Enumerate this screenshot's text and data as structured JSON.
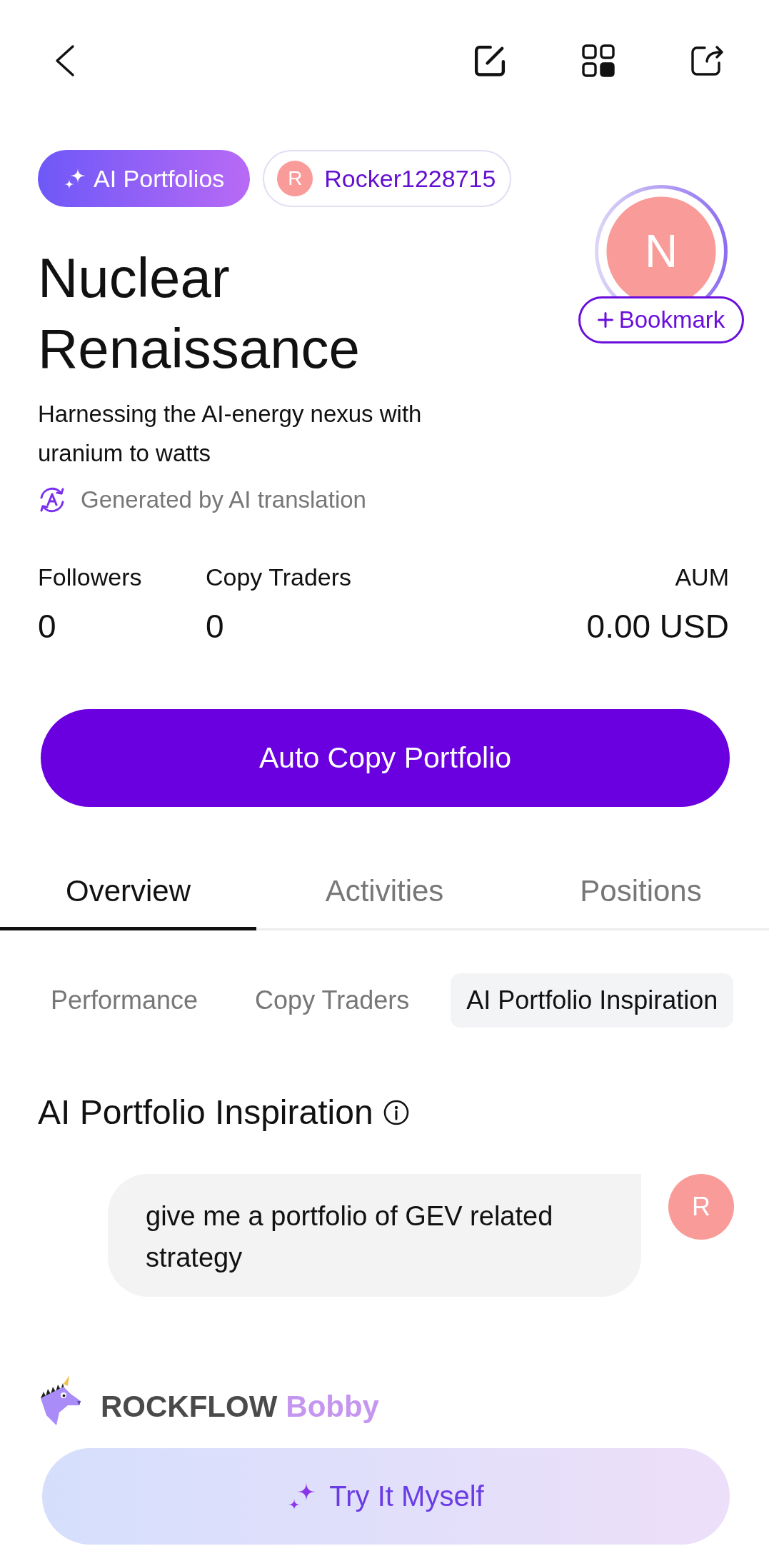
{
  "badges": [
    {
      "kind": "ai",
      "label": "AI Portfolios"
    },
    {
      "kind": "user",
      "initial": "R",
      "label": "Rocker1228715"
    }
  ],
  "portfolio": {
    "title": "Nuclear Renaissance",
    "avatar_initial": "N",
    "bookmark": "Bookmark",
    "description": "Harnessing the AI-energy nexus with uranium to watts",
    "translation_note": "Generated by AI translation"
  },
  "stats": [
    {
      "label": "Followers",
      "value": "0"
    },
    {
      "label": "Copy Traders",
      "value": "0"
    },
    {
      "label": "AUM",
      "value": "0.00 USD"
    }
  ],
  "primary_button": "Auto Copy Portfolio",
  "tabs": [
    {
      "label": "Overview",
      "selected": true
    },
    {
      "label": "Activities",
      "selected": false
    },
    {
      "label": "Positions",
      "selected": false
    }
  ],
  "sub_tabs": [
    {
      "label": "Performance",
      "selected": false
    },
    {
      "label": "Copy Traders",
      "selected": false
    },
    {
      "label": "AI Portfolio Inspiration",
      "selected": true
    }
  ],
  "section": {
    "title": "AI Portfolio Inspiration",
    "messages": [
      {
        "kind": "user",
        "initial": "R",
        "text": "give me a portfolio of GEV related strategy"
      }
    ]
  },
  "footer": {
    "brand": "ROCKFLOW",
    "assistant": "Bobby",
    "button": "Try It Myself"
  }
}
